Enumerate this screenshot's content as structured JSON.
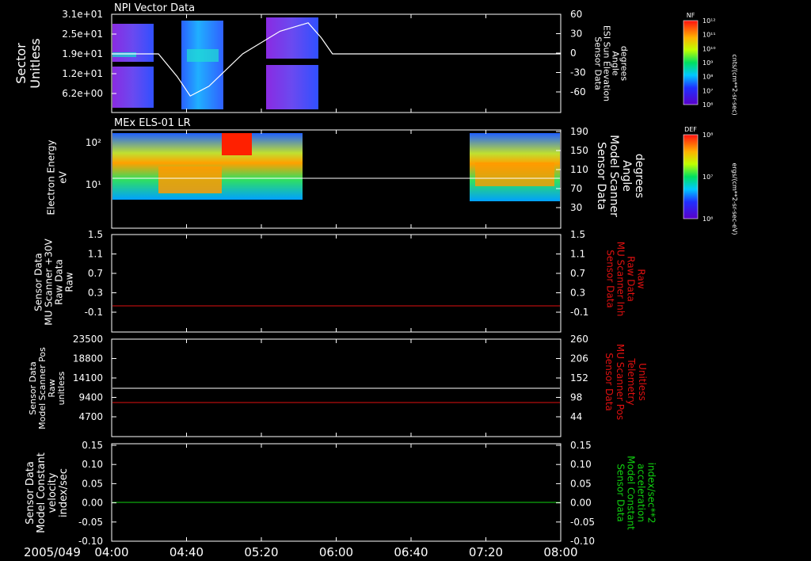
{
  "colors": {
    "white": "#ffffff",
    "red": "#e01010",
    "green": "#10d010"
  },
  "date_label": "2005/049",
  "time_ticks": [
    "04:00",
    "04:40",
    "05:20",
    "06:00",
    "06:40",
    "07:20",
    "08:00"
  ],
  "panel1": {
    "title": "NPI Vector Data",
    "ylabel": [
      "Sector",
      "Unitless"
    ],
    "left_ticks": [
      "3.1e+01",
      "2.5e+01",
      "1.9e+01",
      "1.2e+01",
      "6.2e+00"
    ],
    "right_label": [
      "Sensor Data",
      "ESI Sun Elevation",
      "Angle",
      "degrees"
    ],
    "right_ticks": [
      "60",
      "30",
      "0",
      "-30",
      "-60"
    ],
    "colorbar_title": "NF",
    "colorbar_ticks": [
      "10¹²",
      "10¹¹",
      "10¹⁰",
      "10⁹",
      "10⁸",
      "10⁷",
      "10⁶"
    ],
    "colorbar_units": "cnts/(cm**2-sr-sec)"
  },
  "panel2": {
    "title": "MEx ELS-01 LR",
    "ylabel": [
      "Electron Energy",
      "eV"
    ],
    "left_ticks": [
      "10²",
      "10¹"
    ],
    "right_label": [
      "Sensor Data",
      "Model Scanner",
      "Angle",
      "degrees"
    ],
    "right_ticks": [
      "190",
      "150",
      "110",
      "70",
      "30"
    ],
    "colorbar_title": "DEF",
    "colorbar_ticks": [
      "10⁸",
      "10⁷",
      "10⁶"
    ],
    "colorbar_units": "ergs/(cm**2-sr-sec-eV)"
  },
  "panel3": {
    "left_label": [
      "Sensor Data",
      "MU Scanner +30V",
      "Raw Data",
      "Raw"
    ],
    "left_ticks": [
      "1.5",
      "1.1",
      "0.7",
      "0.3",
      "-0.1"
    ],
    "right_label": [
      "Sensor Data",
      "MU Scanner Inh",
      "Raw Data",
      "Raw"
    ],
    "right_ticks": [
      "1.5",
      "1.1",
      "0.7",
      "0.3",
      "-0.1"
    ]
  },
  "panel4": {
    "left_label": [
      "Sensor Data",
      "Model Scanner Pos",
      "Raw",
      "unitless"
    ],
    "left_ticks": [
      "23500",
      "18800",
      "14100",
      "9400",
      "4700"
    ],
    "right_label": [
      "Sensor Data",
      "MU Scanner Pos",
      "Telemetry",
      "Unitless"
    ],
    "right_ticks": [
      "260",
      "206",
      "152",
      "98",
      "44"
    ]
  },
  "panel5": {
    "left_label": [
      "Sensor Data",
      "Model Constant",
      "velocity",
      "index/sec"
    ],
    "left_ticks": [
      "0.15",
      "0.10",
      "0.05",
      "0.00",
      "-0.05",
      "-0.10"
    ],
    "right_label": [
      "Sensor Data",
      "Model Constant",
      "acceleration",
      "index/sec**2"
    ],
    "right_ticks": [
      "0.15",
      "0.10",
      "0.05",
      "0.00",
      "-0.05",
      "-0.10"
    ]
  },
  "chart_data": [
    {
      "type": "heatmap",
      "title": "NPI Vector Data",
      "x_range": [
        "04:00",
        "08:00"
      ],
      "ylim": [
        0,
        31
      ],
      "data_blocks": [
        [
          "04:00",
          "04:25"
        ],
        [
          "04:36",
          "05:08"
        ],
        [
          "05:35",
          "05:58"
        ]
      ],
      "series": [
        {
          "name": "ESI Sun Elevation Angle",
          "x": [
            "04:00",
            "04:25",
            "04:35",
            "04:42",
            "04:52",
            "05:10",
            "05:30",
            "05:45",
            "05:52",
            "05:58",
            "06:05",
            "08:00"
          ],
          "values": [
            0,
            0,
            -35,
            -65,
            -50,
            0,
            35,
            48,
            25,
            0,
            0,
            0
          ]
        }
      ]
    },
    {
      "type": "heatmap",
      "title": "MEx ELS-01 LR",
      "x_range": [
        "04:00",
        "08:00"
      ],
      "yscale": "log",
      "data_blocks": [
        [
          "04:00",
          "05:44"
        ],
        [
          "07:12",
          "08:00"
        ]
      ],
      "series": [
        {
          "name": "Model Scanner Angle",
          "values": [
            90
          ]
        }
      ]
    },
    {
      "type": "line",
      "ylim": [
        -0.3,
        1.5
      ],
      "series": [
        {
          "name": "MU Scanner Inh",
          "values": [
            0
          ]
        }
      ]
    },
    {
      "type": "line",
      "series": [
        {
          "name": "Model Scanner Pos",
          "values": [
            11800
          ]
        },
        {
          "name": "MU Scanner Pos",
          "values": [
            90
          ]
        }
      ]
    },
    {
      "type": "line",
      "ylim": [
        -0.1,
        0.15
      ],
      "series": [
        {
          "name": "Model Constant velocity",
          "values": [
            0
          ]
        },
        {
          "name": "Model Constant acceleration",
          "values": [
            0
          ]
        }
      ]
    }
  ]
}
